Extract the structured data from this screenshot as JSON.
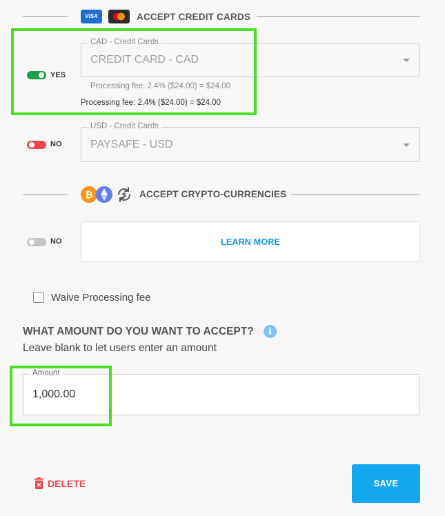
{
  "credit_section": {
    "title": "ACCEPT CREDIT CARDS",
    "visa_text": "VISA"
  },
  "cad_row": {
    "toggle_label": "YES",
    "field_legend": "CAD - Credit Cards",
    "field_value": "CREDIT CARD - CAD",
    "fee_grey": "Processing fee: 2.4% ($24.00) = $24.00",
    "fee_dark": "Processing fee: 2.4% ($24.00) = $24.00"
  },
  "usd_row": {
    "toggle_label": "NO",
    "field_legend": "USD - Credit Cards",
    "field_value": "PAYSAFE - USD"
  },
  "crypto_section": {
    "title": "ACCEPT CRYPTO-CURRENCIES"
  },
  "crypto_row": {
    "toggle_label": "NO",
    "learn_more": "LEARN MORE"
  },
  "waive": {
    "label": "Waive Processing fee"
  },
  "amount": {
    "question": "WHAT AMOUNT DO YOU WANT TO ACCEPT?",
    "info_glyph": "i",
    "hint": "Leave blank to let users enter an amount",
    "legend": "Amount",
    "value": "1,000.00"
  },
  "actions": {
    "delete_label": "DELETE",
    "save_label": "SAVE"
  },
  "colors": {
    "toggle_on": "#1e9e4a",
    "toggle_off_red": "#e5484d",
    "toggle_off_grey": "#c4c4c4",
    "link_blue": "#1798e3",
    "save_blue": "#14a6ef",
    "delete_red": "#e5484d",
    "highlight_green": "#4bde25"
  }
}
